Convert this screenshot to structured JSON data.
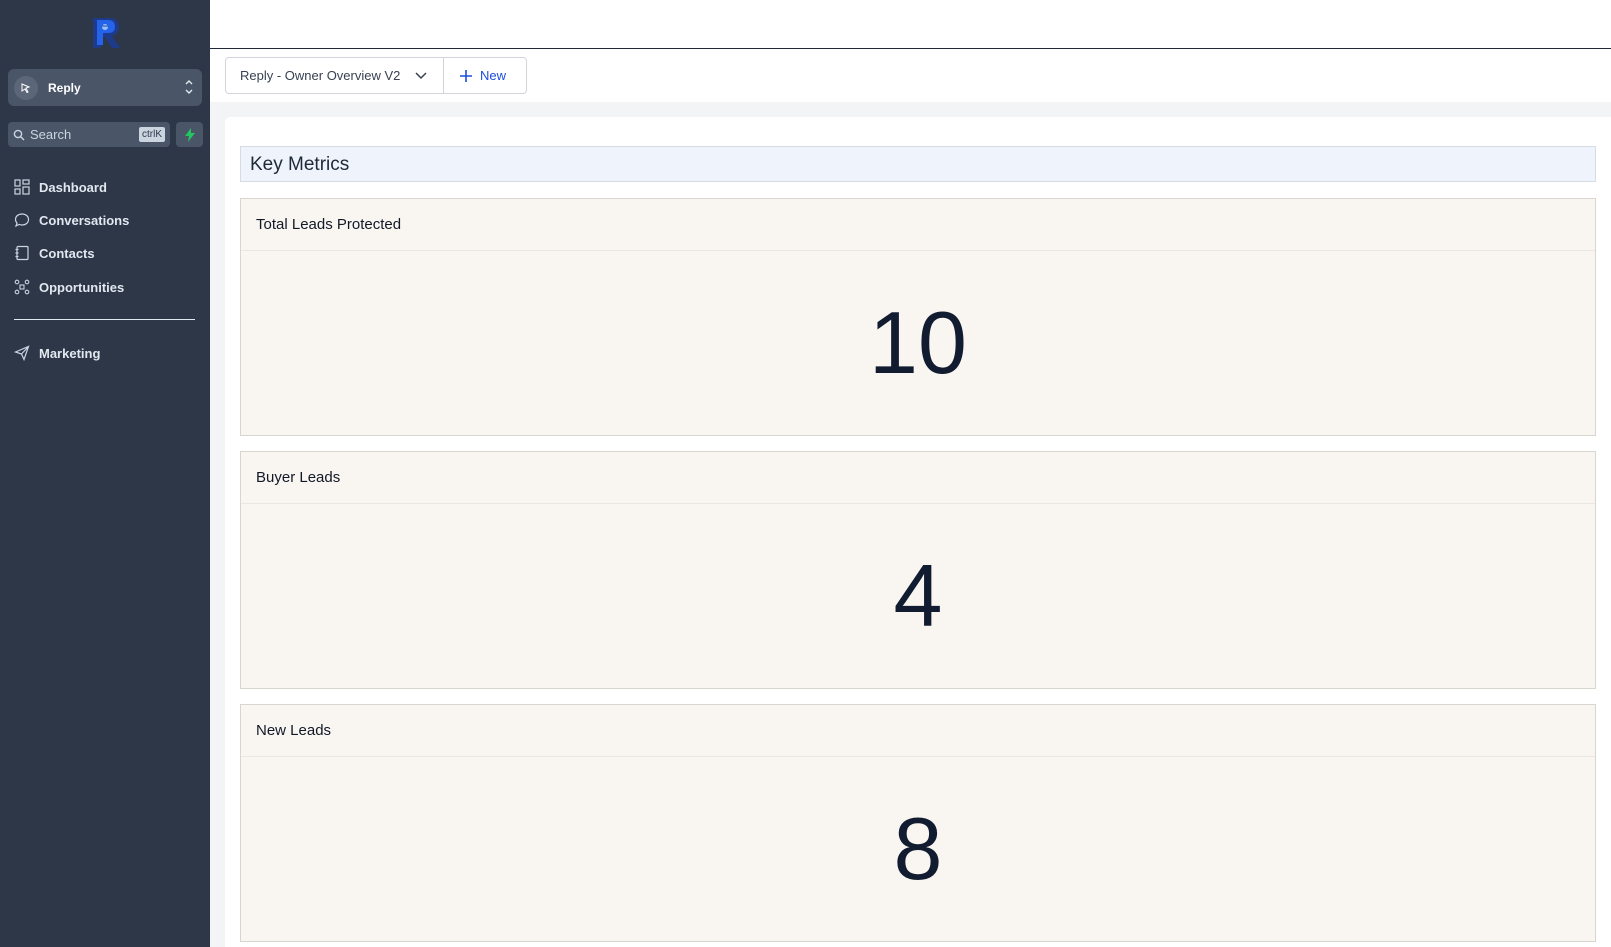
{
  "sidebar": {
    "account": {
      "name": "Reply"
    },
    "search": {
      "placeholder": "Search",
      "shortcut": "ctrlK"
    },
    "nav": [
      {
        "label": "Dashboard",
        "icon": "dashboard-icon"
      },
      {
        "label": "Conversations",
        "icon": "chat-bubble-icon"
      },
      {
        "label": "Contacts",
        "icon": "contacts-book-icon"
      },
      {
        "label": "Opportunities",
        "icon": "opportunities-icon"
      },
      {
        "label": "Marketing",
        "icon": "send-icon"
      }
    ]
  },
  "toolbar": {
    "view_label": "Reply - Owner Overview V2",
    "new_label": "New"
  },
  "dashboard": {
    "section_title": "Key Metrics",
    "cards": [
      {
        "title": "Total Leads Protected",
        "value": "10"
      },
      {
        "title": "Buyer Leads",
        "value": "4"
      },
      {
        "title": "New Leads",
        "value": "8"
      }
    ]
  },
  "colors": {
    "sidebar_bg": "#2d3748",
    "accent": "#1d4ed8",
    "bolt": "#22c55e",
    "card_bg": "#f9f6f1"
  }
}
